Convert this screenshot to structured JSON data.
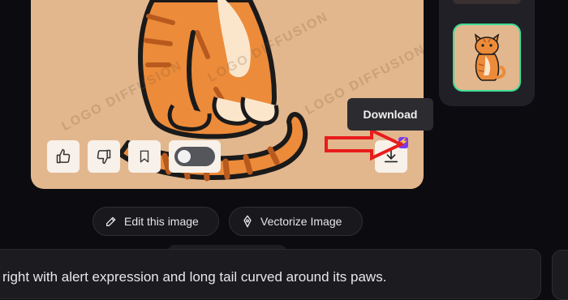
{
  "image_card": {
    "watermark": "LOGO DIFFUSION",
    "actions": {
      "like": "thumbs-up-icon",
      "dislike": "thumbs-down-icon",
      "bookmark": "bookmark-icon",
      "toggle_state": "off"
    },
    "download_tooltip": "Download",
    "premium_badge": "⚡"
  },
  "actions_bar": {
    "edit_label": "Edit this image",
    "vectorize_label": "Vectorize Image"
  },
  "prompt": {
    "text": "right with alert expression and long tail curved around its paws."
  },
  "colors": {
    "background": "#0c0c10",
    "image_bg": "#e2b78d",
    "selected_border": "#3ddc97",
    "annotation_arrow": "#e81c1c",
    "badge": "#7c3aed"
  }
}
